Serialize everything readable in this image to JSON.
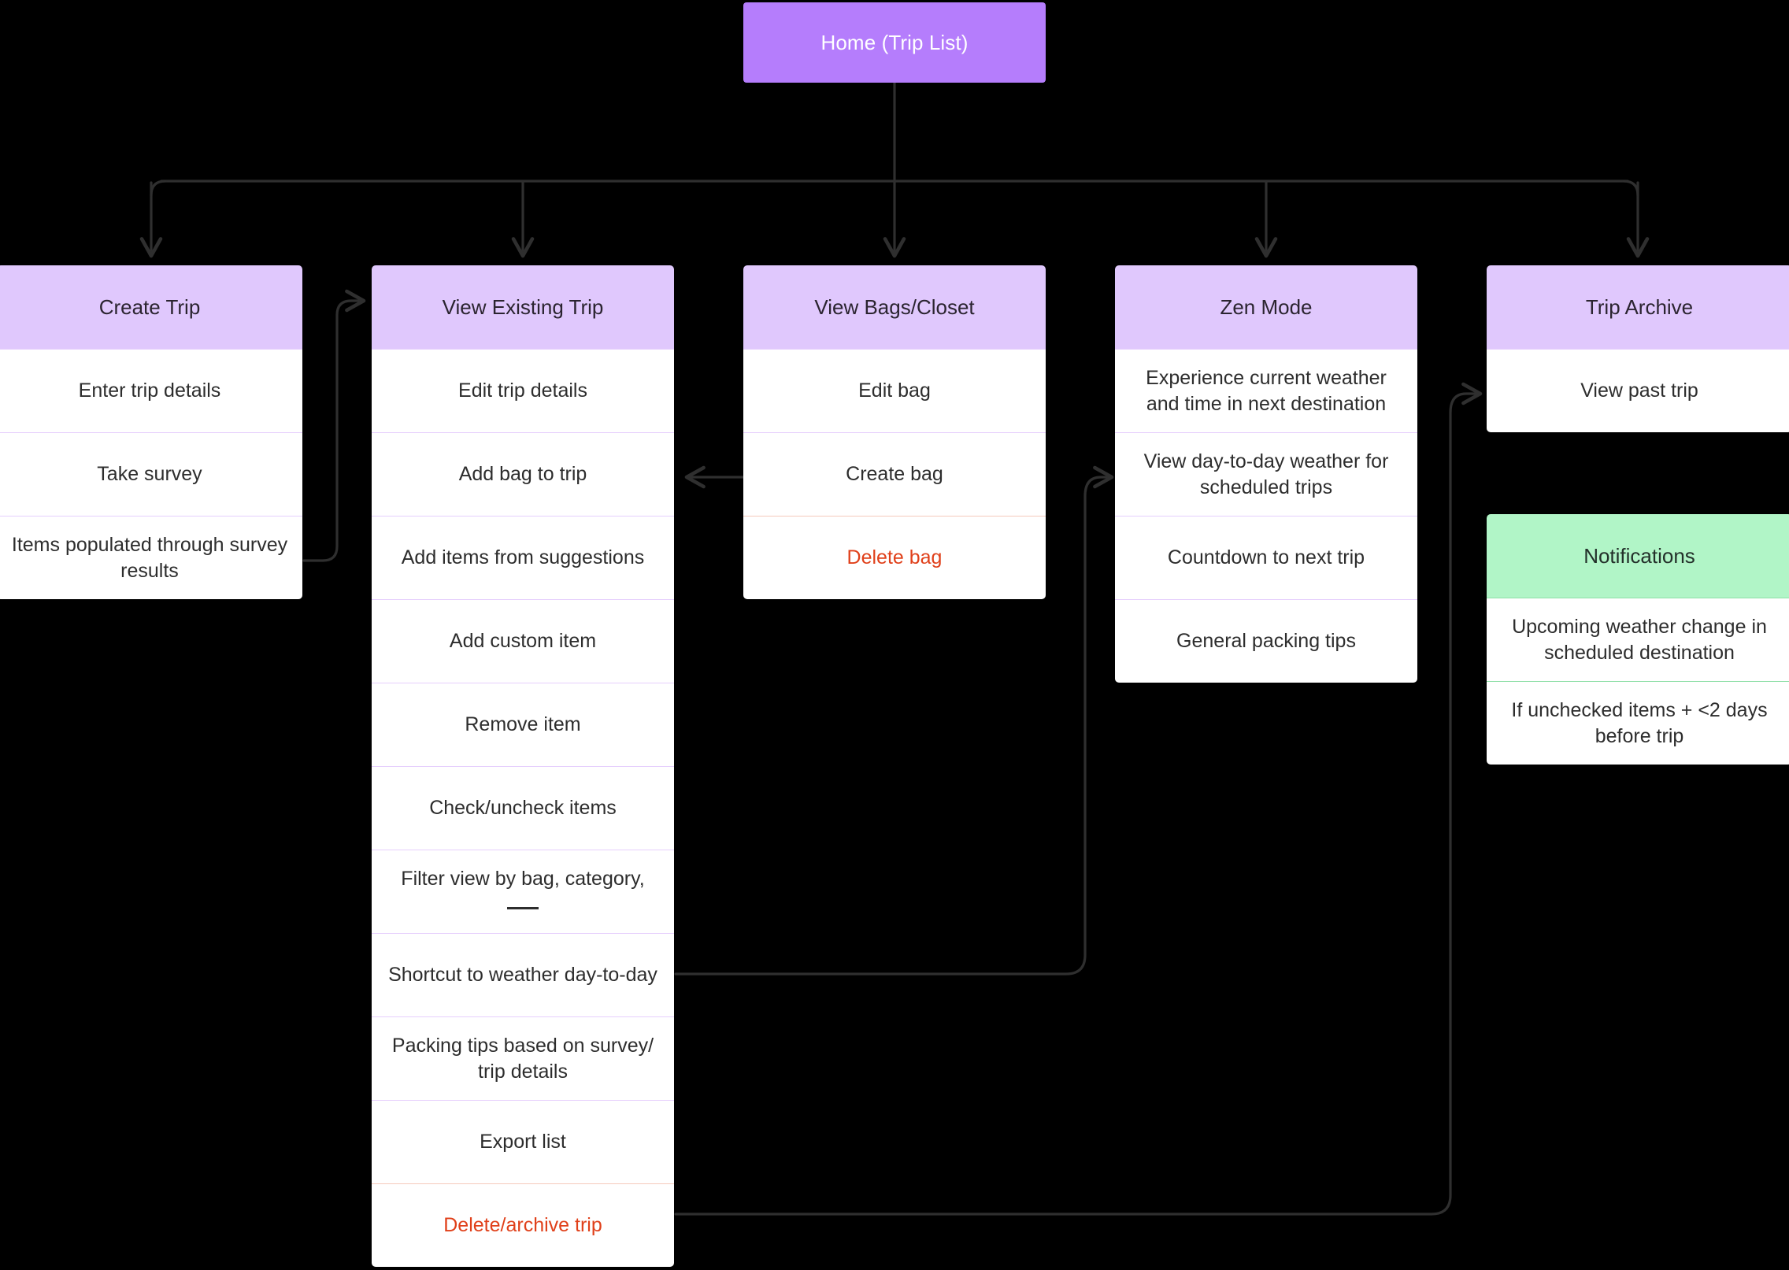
{
  "diagram": {
    "title_node": {
      "label": "Home (Trip List)",
      "color": "#b57dfc",
      "text_color": "#ffffff"
    },
    "palette": {
      "background": "#000000",
      "header_purple": "#e0c8fd",
      "header_green": "#b1f5c7",
      "row_white": "#ffffff",
      "row_border_purple": "#e6cffd",
      "row_border_green": "#8fdfa8",
      "danger_text": "#e0401a",
      "body_text": "#2d2d2d",
      "connector": "#2f2f2f"
    },
    "groups": [
      {
        "id": "create-trip",
        "header": "Create Trip",
        "header_style": "purple",
        "rows": [
          {
            "text": "Enter trip details",
            "style": "normal"
          },
          {
            "text": "Take survey",
            "style": "normal"
          },
          {
            "text": "Items populated through survey results",
            "style": "normal"
          }
        ]
      },
      {
        "id": "view-existing-trip",
        "header": "View Existing Trip",
        "header_style": "purple",
        "rows": [
          {
            "text": "Edit trip details",
            "style": "normal"
          },
          {
            "text": "Add bag to trip",
            "style": "normal"
          },
          {
            "text": "Add items from suggestions",
            "style": "normal"
          },
          {
            "text": "Add custom item",
            "style": "normal"
          },
          {
            "text": "Remove item",
            "style": "normal"
          },
          {
            "text": "Check/uncheck items",
            "style": "normal"
          },
          {
            "text": "Filter view by bag, category, ___",
            "style": "blank"
          },
          {
            "text": "Shortcut to weather day-to-day",
            "style": "normal"
          },
          {
            "text": "Packing tips based on survey/ trip details",
            "style": "normal"
          },
          {
            "text": "Export list",
            "style": "normal"
          },
          {
            "text": "Delete/archive trip",
            "style": "danger"
          }
        ]
      },
      {
        "id": "view-bags-closet",
        "header": "View Bags/Closet",
        "header_style": "purple",
        "rows": [
          {
            "text": "Edit bag",
            "style": "normal"
          },
          {
            "text": "Create bag",
            "style": "normal"
          },
          {
            "text": "Delete bag",
            "style": "danger"
          }
        ]
      },
      {
        "id": "zen-mode",
        "header": "Zen Mode",
        "header_style": "purple",
        "rows": [
          {
            "text": "Experience current weather and time in next destination",
            "style": "normal"
          },
          {
            "text": "View day-to-day weather for scheduled trips",
            "style": "normal"
          },
          {
            "text": "Countdown to next trip",
            "style": "normal"
          },
          {
            "text": "General packing tips",
            "style": "normal"
          }
        ]
      },
      {
        "id": "trip-archive",
        "header": "Trip Archive",
        "header_style": "purple",
        "rows": [
          {
            "text": "View past trip",
            "style": "normal"
          }
        ]
      },
      {
        "id": "notifications",
        "header": "Notifications",
        "header_style": "green",
        "rows": [
          {
            "text": "Upcoming weather change in scheduled destination",
            "style": "green"
          },
          {
            "text": "If unchecked items + <2 days before trip",
            "style": "green"
          }
        ]
      }
    ],
    "connections": [
      {
        "from": "Home (Trip List)",
        "to": "Create Trip"
      },
      {
        "from": "Home (Trip List)",
        "to": "View Existing Trip"
      },
      {
        "from": "Home (Trip List)",
        "to": "View Bags/Closet"
      },
      {
        "from": "Home (Trip List)",
        "to": "Zen Mode"
      },
      {
        "from": "Home (Trip List)",
        "to": "Trip Archive"
      },
      {
        "from": "Items populated through survey results",
        "to": "View Existing Trip"
      },
      {
        "from": "Create bag",
        "to": "Add bag to trip"
      },
      {
        "from": "Shortcut to weather day-to-day",
        "to": "View day-to-day weather for scheduled trips"
      },
      {
        "from": "Delete/archive trip",
        "to": "View past trip"
      }
    ]
  }
}
